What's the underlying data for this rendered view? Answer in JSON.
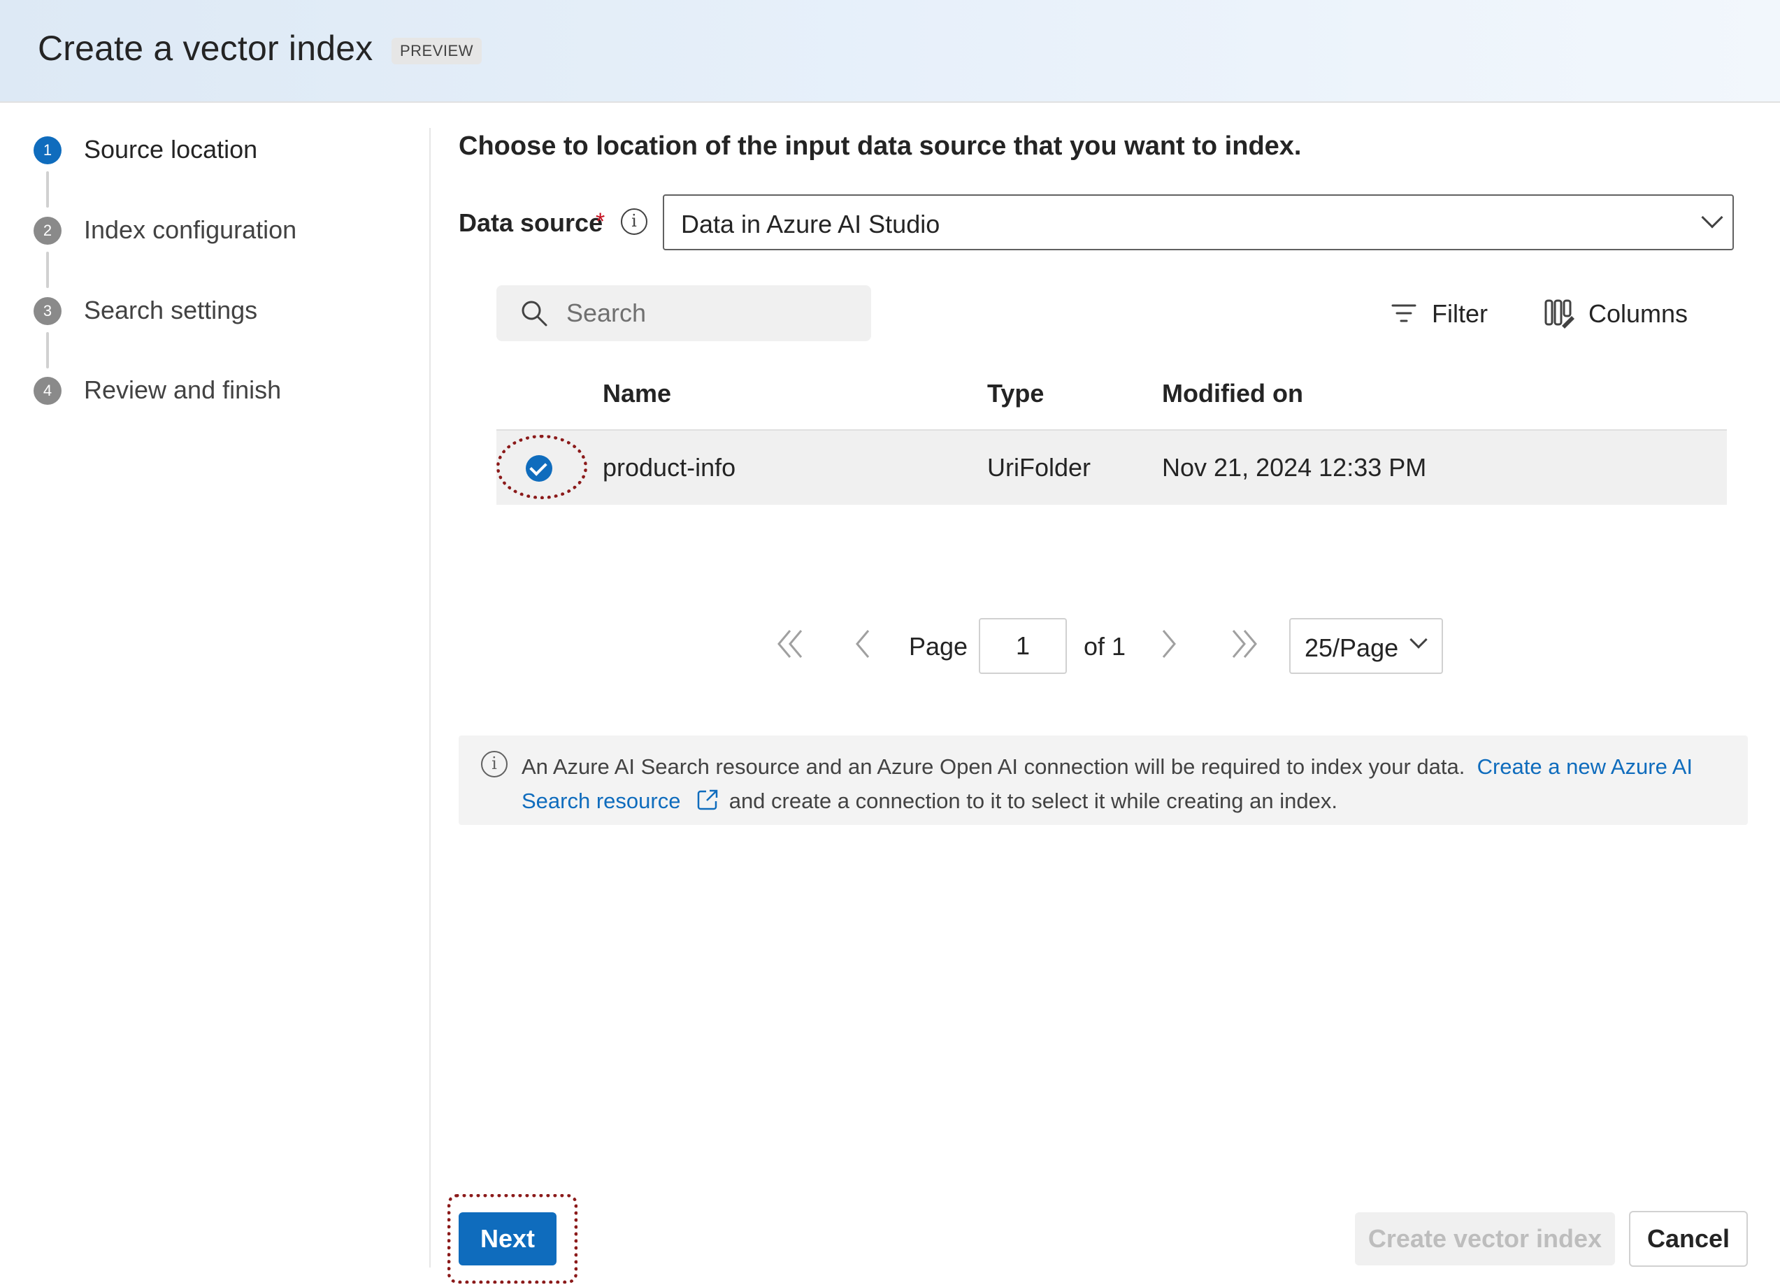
{
  "dialog": {
    "title": "Create a vector index",
    "badge": "PREVIEW"
  },
  "stepper": {
    "steps": [
      {
        "number": "1",
        "label": "Source location",
        "state": "active"
      },
      {
        "number": "2",
        "label": "Index configuration",
        "state": "pending"
      },
      {
        "number": "3",
        "label": "Search settings",
        "state": "pending"
      },
      {
        "number": "4",
        "label": "Review and finish",
        "state": "pending"
      }
    ]
  },
  "main": {
    "heading": "Choose to location of the input data source that you want to index.",
    "data_source": {
      "label": "Data source",
      "required_marker": "*",
      "info_icon": "info-icon",
      "value": "Data in Azure AI Studio"
    },
    "search": {
      "placeholder": "Search",
      "icon": "search-icon"
    },
    "toolbar": {
      "filter_label": "Filter",
      "filter_icon": "filter-icon",
      "columns_label": "Columns",
      "columns_icon": "columns-icon"
    },
    "table": {
      "columns": [
        "Name",
        "Type",
        "Modified on"
      ],
      "rows": [
        {
          "selected": true,
          "name": "product-info",
          "type": "UriFolder",
          "modified": "Nov 21, 2024 12:33 PM"
        }
      ]
    },
    "pagination": {
      "page_label": "Page",
      "page_value": "1",
      "of_label": "of 1",
      "page_size": "25/Page"
    },
    "info_bar": {
      "text_before": "An Azure AI Search resource and an Azure Open AI connection will be required to index your data.",
      "link_text": "Create a new Azure AI Search resource",
      "text_after": "and create a connection to it to select it while creating an index."
    }
  },
  "footer": {
    "next_label": "Next",
    "create_label": "Create vector index",
    "cancel_label": "Cancel"
  },
  "colors": {
    "accent": "#0f6cbd",
    "highlight_annotation": "#8b1a1a",
    "required": "#c50f1f",
    "header_gradient_start": "#dde9f5",
    "header_gradient_end": "#f2f7fc"
  }
}
